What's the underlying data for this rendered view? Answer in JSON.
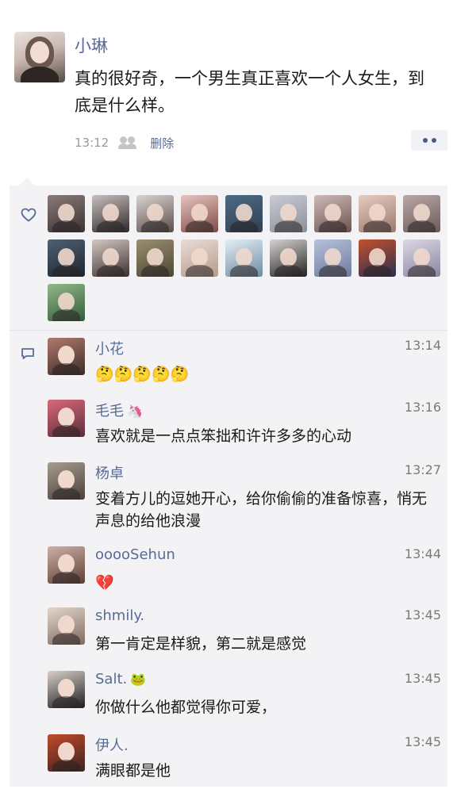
{
  "post": {
    "author": "小琳",
    "text": "真的很好奇，一个男生真正喜欢一个人女生，到底是什么样。",
    "time": "13:12",
    "delete_label": "删除"
  },
  "icons": {
    "like": "heart-outline-icon",
    "comment": "comment-bubble-icon",
    "group": "group-visibility-icon",
    "more": "more-dots-icon"
  },
  "likes": {
    "count_visible": 19,
    "avatar_colors": [
      [
        "#8a7a78",
        "#3b3333"
      ],
      [
        "#c7bfbd",
        "#2e2a2b"
      ],
      [
        "#d9d4d0",
        "#5b4d4d"
      ],
      [
        "#e7c4c0",
        "#7d4b47"
      ],
      [
        "#4e6a86",
        "#2f4050"
      ],
      [
        "#c9ccd4",
        "#8a8e98"
      ],
      [
        "#cdbab6",
        "#6c5252"
      ],
      [
        "#e6cbbf",
        "#9b7a6f"
      ],
      [
        "#b8a8a8",
        "#6a5a5a"
      ],
      [
        "#4f6071",
        "#1e2630"
      ],
      [
        "#d5c8c2",
        "#3a3030"
      ],
      [
        "#9a8f6f",
        "#4c4634"
      ],
      [
        "#e9ddd6",
        "#b49a8c"
      ],
      [
        "#e3eef4",
        "#6d8aa0"
      ],
      [
        "#d8d2d2",
        "#222222"
      ],
      [
        "#b6c1d8",
        "#6d7ba0"
      ],
      [
        "#c4512b",
        "#2a2f52"
      ],
      [
        "#dcd7e6",
        "#8b84a0"
      ],
      [
        "#93b88a",
        "#345a3b"
      ]
    ]
  },
  "comments": [
    {
      "name": "小花",
      "badge": "",
      "time": "13:14",
      "text": "🤔🤔🤔🤔🤔",
      "colors": [
        "#b07a6c",
        "#3b2b28"
      ]
    },
    {
      "name": "毛毛",
      "badge": "🦄",
      "time": "13:16",
      "text": "喜欢就是一点点笨拙和许许多多的心动",
      "colors": [
        "#d86a7a",
        "#5a2d3a"
      ]
    },
    {
      "name": "杨卓",
      "badge": "",
      "time": "13:27",
      "text": "变着方儿的逗她开心，给你偷偷的准备惊喜，悄无声息的给他浪漫",
      "colors": [
        "#a69c90",
        "#4a4038"
      ]
    },
    {
      "name": "ooooSehun",
      "badge": "",
      "time": "13:44",
      "text": "💔",
      "colors": [
        "#cdb0a6",
        "#5e3e36"
      ]
    },
    {
      "name": "shmily.",
      "badge": "",
      "time": "13:45",
      "text": "第一肯定是样貌，第二就是感觉",
      "colors": [
        "#e4d6cc",
        "#7e6a5e"
      ]
    },
    {
      "name": "Salt.",
      "badge": "🐸",
      "time": "13:45",
      "text": "你做什么他都觉得你可爱，",
      "colors": [
        "#d9d0cc",
        "#1f1c1c"
      ]
    },
    {
      "name": "伊人.",
      "badge": "",
      "time": "13:45",
      "text": "满眼都是他",
      "colors": [
        "#c24a2c",
        "#3a2320"
      ]
    }
  ],
  "colors": {
    "link": "#576b95",
    "panel": "#f3f3f5",
    "text": "#1a1a1a",
    "muted": "#9a9a9a"
  }
}
